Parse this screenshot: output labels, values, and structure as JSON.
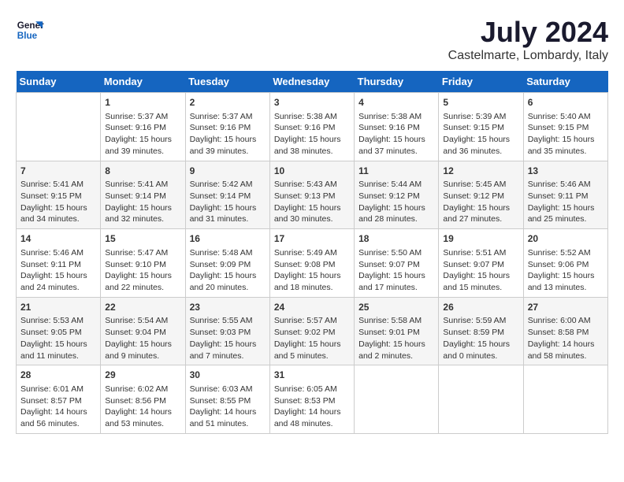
{
  "header": {
    "logo_line1": "General",
    "logo_line2": "Blue",
    "month_year": "July 2024",
    "location": "Castelmarte, Lombardy, Italy"
  },
  "calendar": {
    "days_of_week": [
      "Sunday",
      "Monday",
      "Tuesday",
      "Wednesday",
      "Thursday",
      "Friday",
      "Saturday"
    ],
    "weeks": [
      [
        {
          "day": "",
          "content": ""
        },
        {
          "day": "1",
          "content": "Sunrise: 5:37 AM\nSunset: 9:16 PM\nDaylight: 15 hours\nand 39 minutes."
        },
        {
          "day": "2",
          "content": "Sunrise: 5:37 AM\nSunset: 9:16 PM\nDaylight: 15 hours\nand 39 minutes."
        },
        {
          "day": "3",
          "content": "Sunrise: 5:38 AM\nSunset: 9:16 PM\nDaylight: 15 hours\nand 38 minutes."
        },
        {
          "day": "4",
          "content": "Sunrise: 5:38 AM\nSunset: 9:16 PM\nDaylight: 15 hours\nand 37 minutes."
        },
        {
          "day": "5",
          "content": "Sunrise: 5:39 AM\nSunset: 9:15 PM\nDaylight: 15 hours\nand 36 minutes."
        },
        {
          "day": "6",
          "content": "Sunrise: 5:40 AM\nSunset: 9:15 PM\nDaylight: 15 hours\nand 35 minutes."
        }
      ],
      [
        {
          "day": "7",
          "content": "Sunrise: 5:41 AM\nSunset: 9:15 PM\nDaylight: 15 hours\nand 34 minutes."
        },
        {
          "day": "8",
          "content": "Sunrise: 5:41 AM\nSunset: 9:14 PM\nDaylight: 15 hours\nand 32 minutes."
        },
        {
          "day": "9",
          "content": "Sunrise: 5:42 AM\nSunset: 9:14 PM\nDaylight: 15 hours\nand 31 minutes."
        },
        {
          "day": "10",
          "content": "Sunrise: 5:43 AM\nSunset: 9:13 PM\nDaylight: 15 hours\nand 30 minutes."
        },
        {
          "day": "11",
          "content": "Sunrise: 5:44 AM\nSunset: 9:12 PM\nDaylight: 15 hours\nand 28 minutes."
        },
        {
          "day": "12",
          "content": "Sunrise: 5:45 AM\nSunset: 9:12 PM\nDaylight: 15 hours\nand 27 minutes."
        },
        {
          "day": "13",
          "content": "Sunrise: 5:46 AM\nSunset: 9:11 PM\nDaylight: 15 hours\nand 25 minutes."
        }
      ],
      [
        {
          "day": "14",
          "content": "Sunrise: 5:46 AM\nSunset: 9:11 PM\nDaylight: 15 hours\nand 24 minutes."
        },
        {
          "day": "15",
          "content": "Sunrise: 5:47 AM\nSunset: 9:10 PM\nDaylight: 15 hours\nand 22 minutes."
        },
        {
          "day": "16",
          "content": "Sunrise: 5:48 AM\nSunset: 9:09 PM\nDaylight: 15 hours\nand 20 minutes."
        },
        {
          "day": "17",
          "content": "Sunrise: 5:49 AM\nSunset: 9:08 PM\nDaylight: 15 hours\nand 18 minutes."
        },
        {
          "day": "18",
          "content": "Sunrise: 5:50 AM\nSunset: 9:07 PM\nDaylight: 15 hours\nand 17 minutes."
        },
        {
          "day": "19",
          "content": "Sunrise: 5:51 AM\nSunset: 9:07 PM\nDaylight: 15 hours\nand 15 minutes."
        },
        {
          "day": "20",
          "content": "Sunrise: 5:52 AM\nSunset: 9:06 PM\nDaylight: 15 hours\nand 13 minutes."
        }
      ],
      [
        {
          "day": "21",
          "content": "Sunrise: 5:53 AM\nSunset: 9:05 PM\nDaylight: 15 hours\nand 11 minutes."
        },
        {
          "day": "22",
          "content": "Sunrise: 5:54 AM\nSunset: 9:04 PM\nDaylight: 15 hours\nand 9 minutes."
        },
        {
          "day": "23",
          "content": "Sunrise: 5:55 AM\nSunset: 9:03 PM\nDaylight: 15 hours\nand 7 minutes."
        },
        {
          "day": "24",
          "content": "Sunrise: 5:57 AM\nSunset: 9:02 PM\nDaylight: 15 hours\nand 5 minutes."
        },
        {
          "day": "25",
          "content": "Sunrise: 5:58 AM\nSunset: 9:01 PM\nDaylight: 15 hours\nand 2 minutes."
        },
        {
          "day": "26",
          "content": "Sunrise: 5:59 AM\nSunset: 8:59 PM\nDaylight: 15 hours\nand 0 minutes."
        },
        {
          "day": "27",
          "content": "Sunrise: 6:00 AM\nSunset: 8:58 PM\nDaylight: 14 hours\nand 58 minutes."
        }
      ],
      [
        {
          "day": "28",
          "content": "Sunrise: 6:01 AM\nSunset: 8:57 PM\nDaylight: 14 hours\nand 56 minutes."
        },
        {
          "day": "29",
          "content": "Sunrise: 6:02 AM\nSunset: 8:56 PM\nDaylight: 14 hours\nand 53 minutes."
        },
        {
          "day": "30",
          "content": "Sunrise: 6:03 AM\nSunset: 8:55 PM\nDaylight: 14 hours\nand 51 minutes."
        },
        {
          "day": "31",
          "content": "Sunrise: 6:05 AM\nSunset: 8:53 PM\nDaylight: 14 hours\nand 48 minutes."
        },
        {
          "day": "",
          "content": ""
        },
        {
          "day": "",
          "content": ""
        },
        {
          "day": "",
          "content": ""
        }
      ]
    ]
  }
}
